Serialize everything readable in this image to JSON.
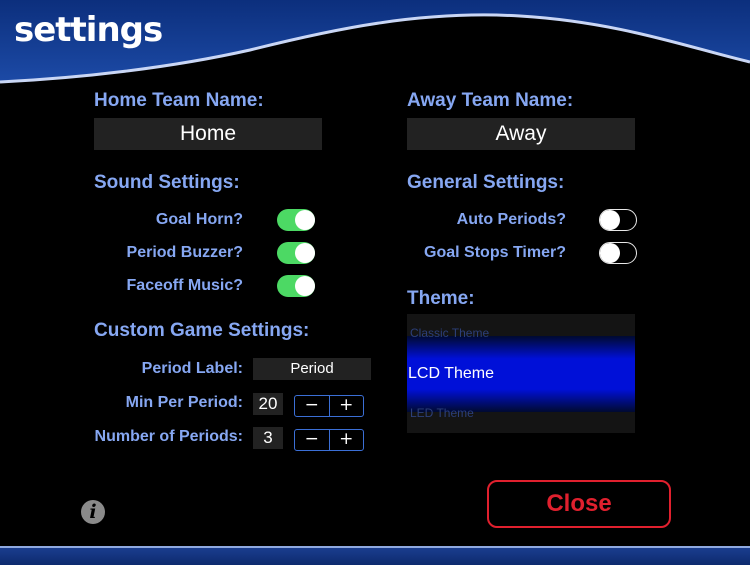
{
  "header": {
    "title": "settings"
  },
  "home_team": {
    "label": "Home Team Name:",
    "value": "Home"
  },
  "away_team": {
    "label": "Away Team Name:",
    "value": "Away"
  },
  "sound_settings": {
    "title": "Sound Settings:",
    "items": [
      {
        "label": "Goal Horn?",
        "state": "on"
      },
      {
        "label": "Period Buzzer?",
        "state": "on"
      },
      {
        "label": "Faceoff Music?",
        "state": "on"
      }
    ]
  },
  "general_settings": {
    "title": "General Settings:",
    "items": [
      {
        "label": "Auto Periods?",
        "state": "off"
      },
      {
        "label": "Goal Stops Timer?",
        "state": "off"
      }
    ]
  },
  "custom_game": {
    "title": "Custom Game Settings:",
    "period_label": {
      "label": "Period Label:",
      "value": "Period"
    },
    "min_per_period": {
      "label": "Min Per Period:",
      "value": "20"
    },
    "num_periods": {
      "label": "Number of Periods:",
      "value": "3"
    },
    "stepper": {
      "minus": "−",
      "plus": "+"
    }
  },
  "theme": {
    "title": "Theme:",
    "options": [
      "Classic Theme",
      "LCD Theme",
      "LED Theme"
    ],
    "selected": "LCD Theme"
  },
  "close_label": "Close",
  "info_icon": {
    "glyph": "i"
  },
  "colors": {
    "accent_label": "#86a7f2",
    "toggle_on": "#4cd964",
    "close_red": "#e0202e",
    "header_blue": "#16408f",
    "theme_selected": "#0010d8"
  }
}
